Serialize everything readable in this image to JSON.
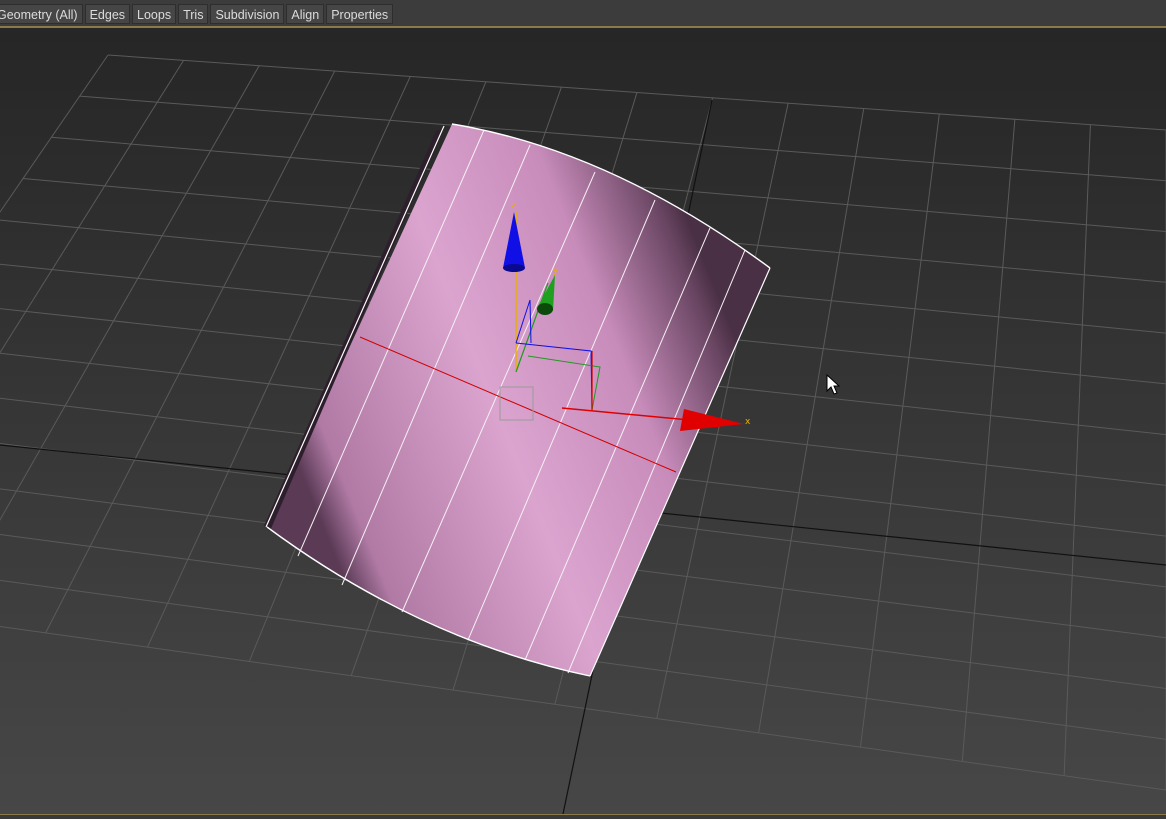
{
  "toolbar": {
    "tabs": [
      {
        "label": "Geometry (All)"
      },
      {
        "label": "Edges"
      },
      {
        "label": "Loops"
      },
      {
        "label": "Tris"
      },
      {
        "label": "Subdivision"
      },
      {
        "label": "Align"
      },
      {
        "label": "Properties"
      }
    ]
  },
  "viewport": {
    "object": "cylinder",
    "object_color": "#d79fcb",
    "grid_color": "#5a5a5a",
    "axes": {
      "x": "x",
      "y": "y",
      "z": "z"
    },
    "axis_colors": {
      "x": "#e00000",
      "y": "#1f9a1f",
      "z": "#1010e0"
    }
  }
}
